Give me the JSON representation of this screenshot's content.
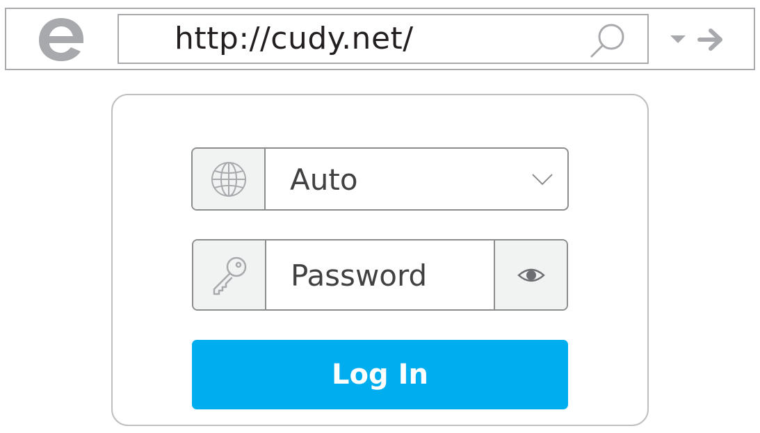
{
  "browser": {
    "url": "http://cudy.net/",
    "logo_icon": "browser-e-logo-icon",
    "search_icon": "search-icon",
    "dropdown_icon": "caret-down-icon",
    "forward_icon": "arrow-right-icon"
  },
  "login": {
    "language": {
      "value": "Auto",
      "icon": "globe-icon",
      "dropdown_icon": "chevron-down-icon"
    },
    "password": {
      "placeholder": "Password",
      "icon": "key-icon",
      "toggle_icon": "eye-icon"
    },
    "submit_label": "Log In"
  },
  "colors": {
    "accent": "#00aeef",
    "border": "#8a8c8e",
    "addon_bg": "#f1f2f2",
    "icon_gray": "#a7a9ac"
  }
}
